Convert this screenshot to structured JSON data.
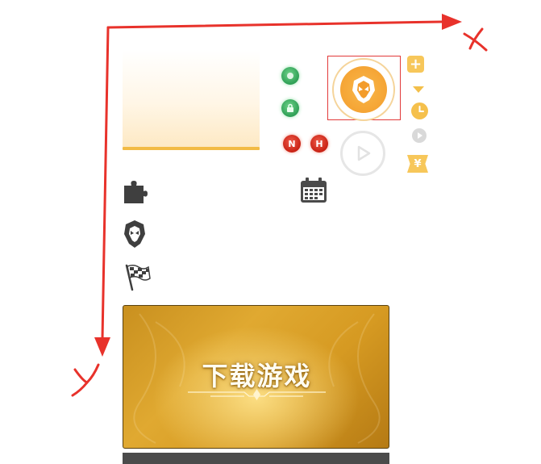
{
  "annotation": {
    "x_axis_label": "X",
    "y_axis_label": "Y",
    "annotation_color": "#e8322b",
    "avatar_highlight_color": "#e23a3a"
  },
  "header": {
    "accent_color": "#f2bb44"
  },
  "status_dots": {
    "dot_1_icon": "circle-icon",
    "dot_2_icon": "lock-icon",
    "badge_n": "N",
    "badge_h": "H"
  },
  "avatar": {
    "icon": "helmet-icon",
    "color": "#f39c2b"
  },
  "right_column": {
    "add_icon": "plus-icon",
    "add_label": "+",
    "dropdown_icon": "caret-down-icon",
    "time_icon": "clock-icon",
    "small_play_icon": "play-icon",
    "currency_label": "¥"
  },
  "left_column": {
    "item_1_icon": "puzzle-icon",
    "item_2_icon": "helmet-icon",
    "item_3_icon": "checkered-flag-icon"
  },
  "calendar": {
    "icon": "calendar-icon"
  },
  "banner": {
    "title": "下载游戏"
  }
}
